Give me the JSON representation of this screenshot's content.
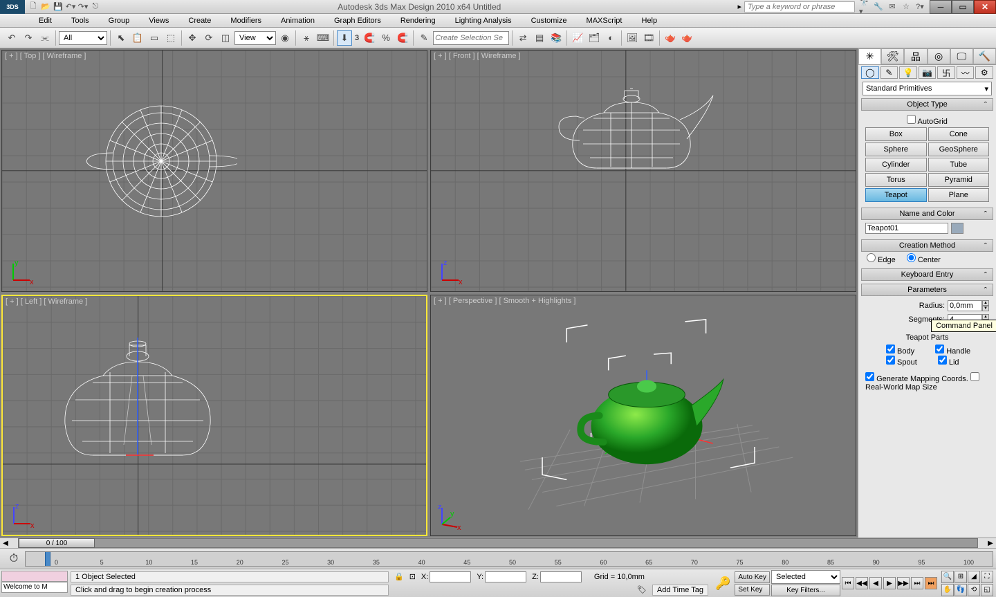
{
  "title": "Autodesk 3ds Max Design 2010 x64     Untitled",
  "app_icon": "3DS",
  "search_placeholder": "Type a keyword or phrase",
  "menus": [
    "Edit",
    "Tools",
    "Group",
    "Views",
    "Create",
    "Modifiers",
    "Animation",
    "Graph Editors",
    "Rendering",
    "Lighting Analysis",
    "Customize",
    "MAXScript",
    "Help"
  ],
  "toolbar": {
    "filter_all": "All",
    "view": "View",
    "snap_angle": "3",
    "selection_set_placeholder": "Create Selection Se"
  },
  "viewports": {
    "top": "[ + ] [ Top ] [ Wireframe ]",
    "front": "[ + ] [ Front ] [ Wireframe ]",
    "left": "[ + ] [ Left ] [ Wireframe ]",
    "perspective": "[ + ] [ Perspective ] [ Smooth + Highlights ]",
    "axis_top": {
      "v": "y",
      "h": "x"
    },
    "axis_front": {
      "v": "z",
      "h": "x"
    },
    "axis_left": {
      "v": "z",
      "h": "x"
    },
    "axis_persp": {
      "v": "z",
      "h": "x",
      "d": "y"
    }
  },
  "command_panel": {
    "dropdown": "Standard Primitives",
    "object_type": "Object Type",
    "autogrid": "AutoGrid",
    "primitives": [
      [
        "Box",
        "Cone"
      ],
      [
        "Sphere",
        "GeoSphere"
      ],
      [
        "Cylinder",
        "Tube"
      ],
      [
        "Torus",
        "Pyramid"
      ],
      [
        "Teapot",
        "Plane"
      ]
    ],
    "selected_primitive": "Teapot",
    "name_and_color": "Name and Color",
    "object_name": "Teapot01",
    "creation_method": "Creation Method",
    "cm_edge": "Edge",
    "cm_center": "Center",
    "keyboard_entry": "Keyboard Entry",
    "parameters": "Parameters",
    "radius_label": "Radius:",
    "radius_value": "0,0mm",
    "segments_label": "Segments:",
    "segments_value": "4",
    "tooltip": "Command Panel",
    "teapot_parts": "Teapot Parts",
    "parts": [
      "Body",
      "Handle",
      "Spout",
      "Lid"
    ],
    "gen_mapping": "Generate Mapping Coords.",
    "real_world": "Real-World Map Size"
  },
  "timeline": {
    "slider_label": "0 / 100",
    "ticks": [
      0,
      5,
      10,
      15,
      20,
      25,
      30,
      35,
      40,
      45,
      50,
      55,
      60,
      65,
      70,
      75,
      80,
      85,
      90,
      95,
      100
    ]
  },
  "status": {
    "welcome": "Welcome to M",
    "selected": "1 Object Selected",
    "hint": "Click and drag to begin creation process",
    "x": "X:",
    "y": "Y:",
    "z": "Z:",
    "grid": "Grid = 10,0mm",
    "add_time_tag": "Add Time Tag",
    "auto_key": "Auto Key",
    "set_key": "Set Key",
    "selected_drop": "Selected",
    "key_filters": "Key Filters..."
  }
}
